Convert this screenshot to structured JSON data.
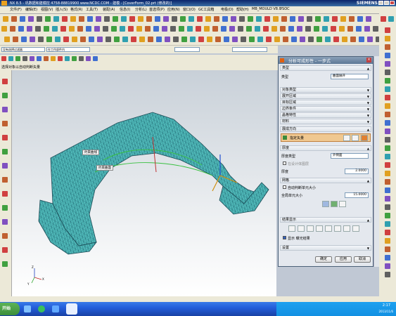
{
  "window": {
    "title": "NX 8.5 - 巩数据和建模控 4758-88819900 www.NCDC.COM - 建模 - [CoverForm_02.prt (修改的)]",
    "brand": "SIEMENS"
  },
  "menu": [
    "文件(F)",
    "编辑(E)",
    "视图(V)",
    "插入(S)",
    "格式(R)",
    "工具(T)",
    "装配(A)",
    "信息(I)",
    "分析(L)",
    "首选项(P)",
    "应用(N)",
    "窗口(O)",
    "GC工具箱",
    "电极(D)",
    "帮助(H)",
    "MB_MOULD V8.0",
    "YSOC"
  ],
  "filterbar": {
    "filter": "没有选择过滤器",
    "assembly": "在工作部件内",
    "snap": "",
    "combo2": "",
    "combo3": ""
  },
  "cue": "选择对象以自动判断矢量",
  "viewport": {
    "label1": "约束曲线",
    "label2": "约束曲面",
    "axis_x": "X",
    "axis_y": "Y",
    "axis_z": "Z"
  },
  "dialog": {
    "title": "分析可成形性 - 一步式",
    "sections": {
      "type": "类型",
      "type_label": "类型",
      "type_value": "曲面展开",
      "object_type": "对象类型",
      "expand_region": "展开区域",
      "target_region": "目标区域",
      "boundary": "边界条件",
      "product_props": "晶格特性",
      "material": "材料",
      "direction": "展成方向",
      "direction_value": "指定矢量",
      "thickness": "厚度",
      "thickness_type_label": "厚度类型",
      "thickness_type_value": "外侧面",
      "inner_check": "在设计体图层",
      "thickness_label": "厚度",
      "thickness_value": "2.0000",
      "mesh": "网格",
      "auto_mesh": "自动判断单元大小",
      "elem_size_label": "全局单元大小",
      "elem_size_value": "15.0000",
      "results": "结果显示",
      "show_results": "显示 曝光结果",
      "settings": "设置"
    },
    "buttons": {
      "ok": "确定",
      "apply": "应用",
      "cancel": "取消"
    }
  },
  "taskbar": {
    "start": "开始",
    "clock": "2:17",
    "date": "2013/11/6"
  }
}
